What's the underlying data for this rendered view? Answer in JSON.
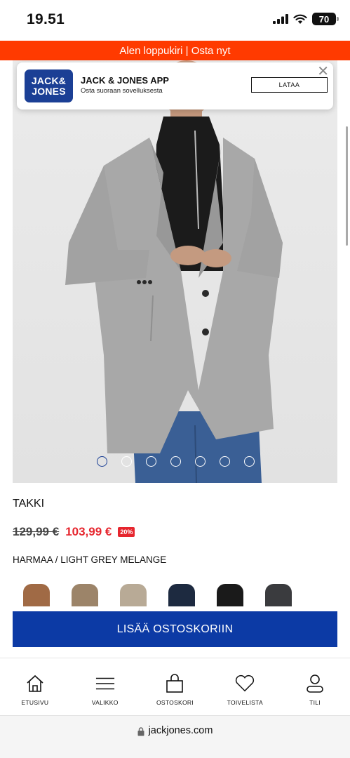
{
  "status": {
    "time": "19.51",
    "battery": "70"
  },
  "promo": {
    "text": "Alen loppukiri | Osta nyt"
  },
  "app_banner": {
    "logo_line1": "JACK&",
    "logo_line2": "JONES",
    "title": "JACK & JONES APP",
    "subtitle": "Osta suoraan sovelluksesta",
    "download_label": "LATAA",
    "close_symbol": "✕"
  },
  "carousel": {
    "count": 7,
    "active": 0
  },
  "product": {
    "title": "TAKKI",
    "old_price": "129,99 €",
    "new_price": "103,99 €",
    "discount": "20%",
    "color_name": "HARMAA / LIGHT GREY MELANGE"
  },
  "swatches": [
    {
      "color": "#a06a45"
    },
    {
      "color": "#9c8469"
    },
    {
      "color": "#b8aa96"
    },
    {
      "color": "#1d2a40"
    },
    {
      "color": "#1a1a1a"
    },
    {
      "color": "#3a3b3e"
    }
  ],
  "cta": {
    "add_to_cart": "LISÄÄ OSTOSKORIIN"
  },
  "nav": {
    "home": "ETUSIVU",
    "menu": "VALIKKO",
    "cart": "OSTOSKORI",
    "wishlist": "TOIVELISTA",
    "account": "TILI"
  },
  "url": {
    "domain": "jackjones.com"
  },
  "colors": {
    "promo": "#ff3a00",
    "brand_blue": "#0c3aa5",
    "sale_red": "#e6262e"
  }
}
